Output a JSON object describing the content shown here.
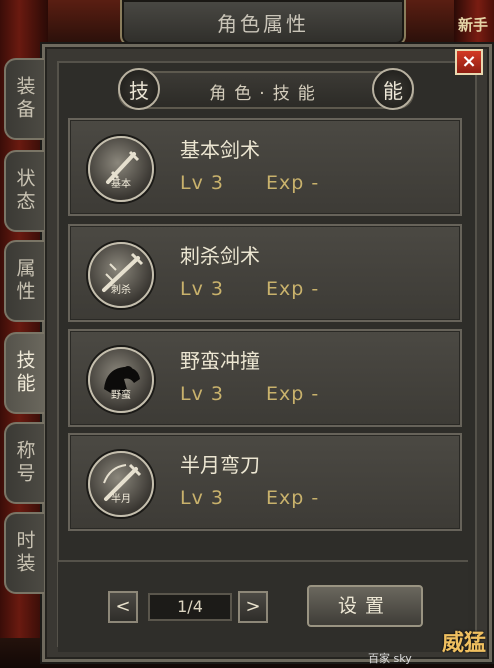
{
  "window": {
    "title": "角色属性",
    "close_label": "×",
    "corner_text": "新手"
  },
  "tabs": [
    {
      "label": "装备",
      "active": false
    },
    {
      "label": "状态",
      "active": false
    },
    {
      "label": "属性",
      "active": false
    },
    {
      "label": "技能",
      "active": true
    },
    {
      "label": "称号",
      "active": false
    },
    {
      "label": "时装",
      "active": false
    }
  ],
  "header": {
    "left_badge": "技",
    "right_badge": "能",
    "label": "角色·技能"
  },
  "skills": [
    {
      "name": "基本剑术",
      "icon_label": "基本",
      "icon": "sword-icon",
      "level": "Lv 3",
      "exp": "Exp -"
    },
    {
      "name": "刺杀剑术",
      "icon_label": "刺杀",
      "icon": "thrust-sword-icon",
      "level": "Lv 3",
      "exp": "Exp -"
    },
    {
      "name": "野蛮冲撞",
      "icon_label": "野蛮",
      "icon": "charge-icon",
      "level": "Lv 3",
      "exp": "Exp -"
    },
    {
      "name": "半月弯刀",
      "icon_label": "半月",
      "icon": "crescent-blade-icon",
      "level": "Lv 3",
      "exp": "Exp -"
    }
  ],
  "footer": {
    "prev_label": "<",
    "next_label": ">",
    "page": "1/4",
    "settings_label": "设置"
  },
  "watermark": "百家 sky",
  "logo_stamp": "威猛",
  "colors": {
    "accent_gold": "#c9b26c",
    "close_red": "#d33a24"
  }
}
